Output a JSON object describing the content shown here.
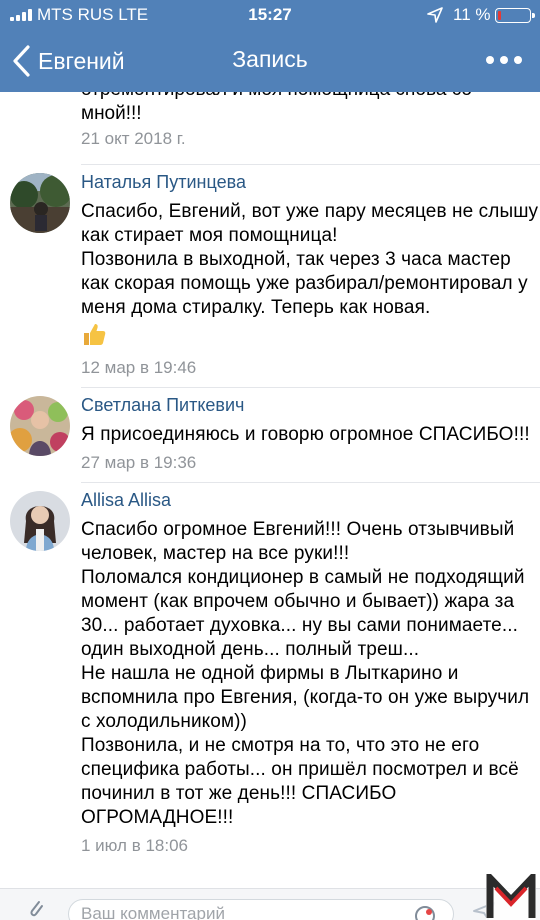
{
  "status_bar": {
    "carrier": "MTS RUS  LTE",
    "time": "15:27",
    "battery_percent": "11 %",
    "battery_level": 0.11,
    "battery_color": "#e53935"
  },
  "nav": {
    "back_label": "Евгений",
    "title": "Запись",
    "more_icon": "more-dots-icon"
  },
  "previous_comment": {
    "text": "отремонтировал и моя помощница снова со мной!!!",
    "date": "21 окт 2018 г."
  },
  "comments": [
    {
      "author": "Наталья Путинцева",
      "text": "Спасибо, Евгений, вот уже пару месяцев не слышу как стирает моя помощница!\nПозвонила в выходной, так через 3 часа мастер как скорая помощь уже разбирал/ремонтировал у меня дома стиралку. Теперь как новая.",
      "emoji": "thumbs-up-icon",
      "date": "12 мар в 19:46"
    },
    {
      "author": "Светлана Питкевич",
      "text": "Я присоединяюсь и говорю огромное СПАСИБО!!!",
      "date": "27 мар в 19:36"
    },
    {
      "author": "Allisa Allisa",
      "text": "Спасибо огромное Евгений!!! Очень отзывчивый человек, мастер на все руки!!!\nПоломался кондиционер в самый не подходящий момент (как впрочем обычно и бывает)) жара за 30... работает духовка... ну вы сами понимаете... один выходной день... полный треш...\nНе нашла не одной фирмы в Лыткарино и вспомнила про Евгения, (когда-то он уже выручил с холодильником))\nПозвонила, и не смотря на то, что это не его специфика работы... он пришёл посмотрел и всё починил в тот же день!!! СПАСИБО ОГРОМАДНОЕ!!!",
      "date": "1 июл в 18:06"
    }
  ],
  "bottom_bar": {
    "input_placeholder": "Ваш комментарий"
  },
  "colors": {
    "accent": "#5181b8",
    "link": "#2a5885",
    "meta": "#909499"
  }
}
